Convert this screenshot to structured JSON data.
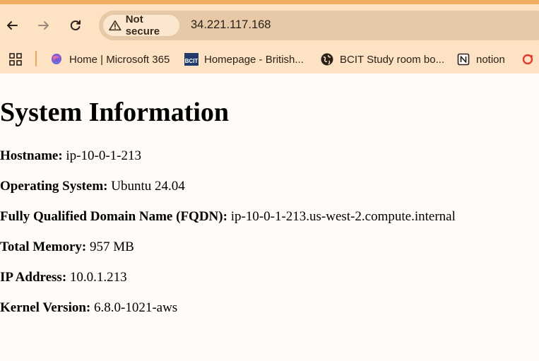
{
  "browser": {
    "security_label": "Not secure",
    "url": "34.221.117.168"
  },
  "bookmarks": [
    {
      "label": "Home | Microsoft 365",
      "icon": "microsoft-365-icon"
    },
    {
      "label": "Homepage - British...",
      "icon": "bcit-icon"
    },
    {
      "label": "BCIT Study room bo...",
      "icon": "globe-icon"
    },
    {
      "label": "notion",
      "icon": "notion-icon"
    }
  ],
  "page": {
    "title": "System Information",
    "rows": [
      {
        "label": "Hostname:",
        "value": "ip-10-0-1-213"
      },
      {
        "label": "Operating System:",
        "value": "Ubuntu 24.04"
      },
      {
        "label": "Fully Qualified Domain Name (FQDN):",
        "value": "ip-10-0-1-213.us-west-2.compute.internal"
      },
      {
        "label": "Total Memory:",
        "value": "957 MB"
      },
      {
        "label": "IP Address:",
        "value": "10.0.1.213"
      },
      {
        "label": "Kernel Version:",
        "value": "6.8.0-1021-aws"
      }
    ]
  },
  "colors": {
    "top_strip": "#f0ad5e",
    "toolbar_bg": "#fde2c4",
    "omnibox_bg": "#e7c9a7",
    "page_bg": "#fffbf6"
  }
}
